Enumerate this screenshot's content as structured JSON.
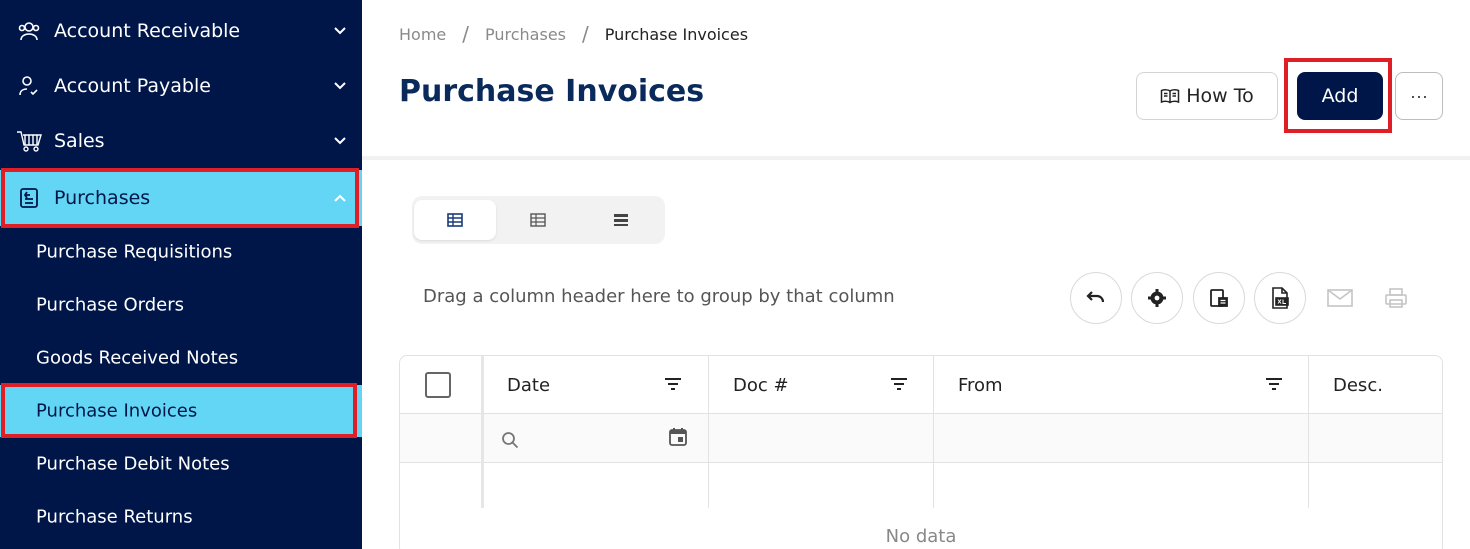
{
  "sidebar": {
    "sections": [
      {
        "label": "Account Receivable",
        "icon": "users-icon",
        "expanded": false
      },
      {
        "label": "Account Payable",
        "icon": "user-check-icon",
        "expanded": false
      },
      {
        "label": "Sales",
        "icon": "cart-icon",
        "expanded": false
      },
      {
        "label": "Purchases",
        "icon": "purchases-icon",
        "expanded": true,
        "active": true
      }
    ],
    "purchase_items": [
      {
        "label": "Purchase Requisitions"
      },
      {
        "label": "Purchase Orders"
      },
      {
        "label": "Goods Received Notes"
      },
      {
        "label": "Purchase Invoices",
        "active": true
      },
      {
        "label": "Purchase Debit Notes"
      },
      {
        "label": "Purchase Returns"
      }
    ]
  },
  "breadcrumb": {
    "items": [
      "Home",
      "Purchases",
      "Purchase Invoices"
    ],
    "separator": "/"
  },
  "header": {
    "title": "Purchase Invoices",
    "howto_label": "How To",
    "add_label": "Add",
    "more_label": "···"
  },
  "toolbar": {
    "group_hint": "Drag a column header here to group by that column"
  },
  "grid": {
    "columns": [
      "Date",
      "Doc #",
      "From",
      "Desc."
    ],
    "empty_text": "No data"
  },
  "colors": {
    "sidebar_bg": "#001649",
    "active_bg": "#62d6f4",
    "title": "#0b2a5c",
    "highlight": "#e01e26"
  }
}
